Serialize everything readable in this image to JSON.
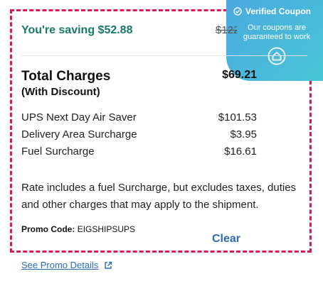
{
  "coupon": {
    "title": "Verified Coupon",
    "subtitle": "Our coupons are guaranteed to work",
    "icon": "house-icon",
    "color": "#4aa9e0"
  },
  "savings": {
    "label": "You're saving $52.88",
    "original_price": "$122.09",
    "color": "#17786b"
  },
  "total": {
    "label": "Total Charges",
    "sub_label": "(With Discount)",
    "value": "$69.21"
  },
  "line_items": [
    {
      "label": "UPS Next Day Air Saver",
      "value": "$101.53"
    },
    {
      "label": "Delivery Area Surcharge",
      "value": "$3.95"
    },
    {
      "label": "Fuel Surcharge",
      "value": "$16.61"
    }
  ],
  "note": "Rate includes a fuel Surcharge, but excludes taxes, duties and other charges that may apply to the shipment.",
  "promo": {
    "label": "Promo Code:",
    "code": "EIGSHIPSUPS",
    "clear_label": "Clear"
  },
  "see_promo_details": "See Promo Details",
  "accent_colors": {
    "border": "#d81b55",
    "link": "#2a6cb5"
  }
}
